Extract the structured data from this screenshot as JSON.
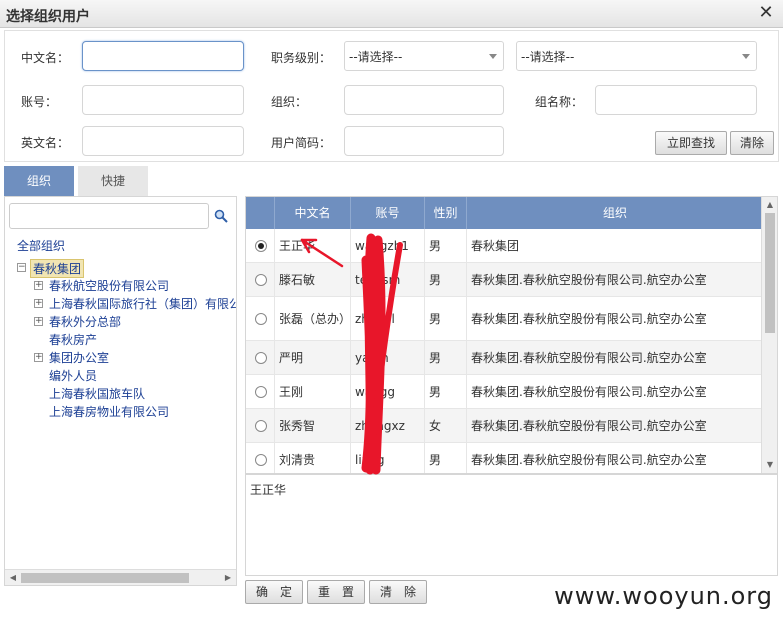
{
  "window": {
    "title": "选择组织用户"
  },
  "form": {
    "chinese_name_label": "中文名：",
    "chinese_name_value": "",
    "job_level_label": "职务级别：",
    "job_level_select_1": "--请选择--",
    "job_level_select_2": "--请选择--",
    "account_label": "账号：",
    "account_value": "",
    "org_label": "组织：",
    "org_value": "",
    "group_name_label": "组名称：",
    "group_name_value": "",
    "english_name_label": "英文名：",
    "english_name_value": "",
    "user_abbr_label": "用户简码：",
    "user_abbr_value": "",
    "search_button": "立即查找",
    "clear_button": "清除"
  },
  "tabs": [
    "组织",
    "快捷"
  ],
  "tree": {
    "all_label": "全部组织",
    "root": "春秋集团",
    "nodes": [
      {
        "label": "春秋航空股份有限公司",
        "expandable": true
      },
      {
        "label": "上海春秋国际旅行社（集团）有限公司",
        "expandable": true
      },
      {
        "label": "春秋外分总部",
        "expandable": true
      },
      {
        "label": "春秋房产",
        "expandable": false
      },
      {
        "label": "集团办公室",
        "expandable": true
      },
      {
        "label": "编外人员",
        "expandable": false
      },
      {
        "label": "上海春秋国旅车队",
        "expandable": false
      },
      {
        "label": "上海春房物业有限公司",
        "expandable": false
      }
    ]
  },
  "grid": {
    "headers": [
      "中文名",
      "账号",
      "性别",
      "组织"
    ],
    "rows": [
      {
        "name": "王正华",
        "account": "wangzh1",
        "gender": "男",
        "org": "春秋集团",
        "selected": true
      },
      {
        "name": "滕石敏",
        "account": "tengsm",
        "gender": "男",
        "org": "春秋集团.春秋航空股份有限公司.航空办公室",
        "selected": false
      },
      {
        "name": "张磊（总办）",
        "account": "zhangl",
        "gender": "男",
        "org": "春秋集团.春秋航空股份有限公司.航空办公室",
        "selected": false
      },
      {
        "name": "严明",
        "account": "yanm",
        "gender": "男",
        "org": "春秋集团.春秋航空股份有限公司.航空办公室",
        "selected": false
      },
      {
        "name": "王刚",
        "account": "wangg",
        "gender": "男",
        "org": "春秋集团.春秋航空股份有限公司.航空办公室",
        "selected": false
      },
      {
        "name": "张秀智",
        "account": "zhangxz",
        "gender": "女",
        "org": "春秋集团.春秋航空股份有限公司.航空办公室",
        "selected": false
      },
      {
        "name": "刘清贵",
        "account": "liuqg",
        "gender": "男",
        "org": "春秋集团.春秋航空股份有限公司.航空办公室",
        "selected": false
      }
    ]
  },
  "selected_users": "王正华",
  "actions": {
    "confirm": "确　定",
    "reset": "重　置",
    "clear": "清　除"
  },
  "watermark": "www.wooyun.org",
  "colors": {
    "header_blue": "#6f8fbf",
    "tree_link": "#1c3f94",
    "annotation_red": "#e8162a"
  }
}
